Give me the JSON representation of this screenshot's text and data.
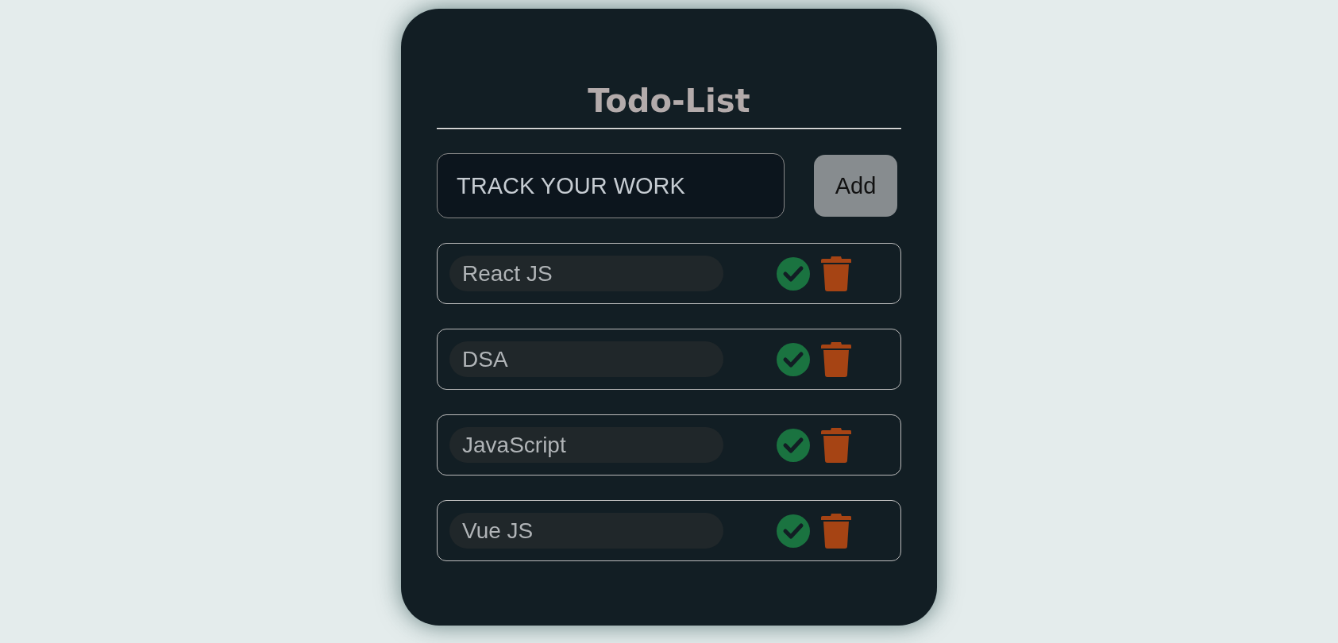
{
  "title": "Todo-List",
  "input": {
    "placeholder": "TRACK YOUR WORK"
  },
  "add_button": "Add",
  "todos": [
    {
      "text": "React JS"
    },
    {
      "text": "DSA"
    },
    {
      "text": "JavaScript"
    },
    {
      "text": "Vue JS"
    }
  ]
}
